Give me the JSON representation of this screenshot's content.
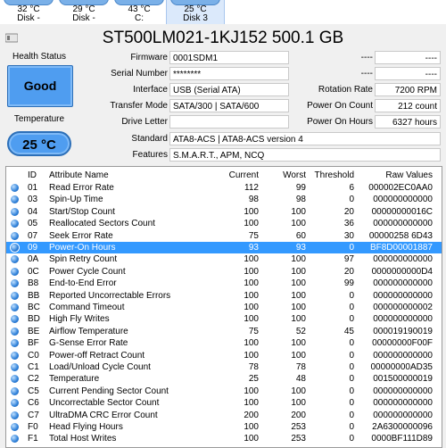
{
  "disks": [
    {
      "temp": "32 °C",
      "name": "Disk -"
    },
    {
      "temp": "29 °C",
      "name": "Disk -"
    },
    {
      "temp": "43 °C",
      "name": "C:"
    },
    {
      "temp": "25 °C",
      "name": "Disk 3"
    }
  ],
  "title": "ST500LM021-1KJ152 500.1 GB",
  "health": {
    "caption": "Health Status",
    "value": "Good",
    "color": "#4f9df0"
  },
  "temperature": {
    "caption": "Temperature",
    "value": "25 °C"
  },
  "info_left": [
    {
      "label": "Firmware",
      "value": "0001SDM1"
    },
    {
      "label": "Serial Number",
      "value": "********"
    },
    {
      "label": "Interface",
      "value": "USB (Serial ATA)"
    },
    {
      "label": "Transfer Mode",
      "value": "SATA/300 | SATA/600"
    },
    {
      "label": "Drive Letter",
      "value": ""
    }
  ],
  "info_right": [
    {
      "label": "----",
      "value": "----"
    },
    {
      "label": "----",
      "value": "----"
    },
    {
      "label": "Rotation Rate",
      "value": "7200 RPM"
    },
    {
      "label": "Power On Count",
      "value": "212 count"
    },
    {
      "label": "Power On Hours",
      "value": "6327 hours"
    }
  ],
  "standard": {
    "label": "Standard",
    "value": "ATA8-ACS | ATA8-ACS version 4"
  },
  "features": {
    "label": "Features",
    "value": "S.M.A.R.T., APM, NCQ"
  },
  "table": {
    "headers": [
      "ID",
      "Attribute Name",
      "Current",
      "Worst",
      "Threshold",
      "Raw Values"
    ],
    "rows": [
      {
        "id": "01",
        "name": "Read Error Rate",
        "cur": "112",
        "worst": "99",
        "thr": "6",
        "raw": "000002EC0AA0"
      },
      {
        "id": "03",
        "name": "Spin-Up Time",
        "cur": "98",
        "worst": "98",
        "thr": "0",
        "raw": "000000000000"
      },
      {
        "id": "04",
        "name": "Start/Stop Count",
        "cur": "100",
        "worst": "100",
        "thr": "20",
        "raw": "00000000016C"
      },
      {
        "id": "05",
        "name": "Reallocated Sectors Count",
        "cur": "100",
        "worst": "100",
        "thr": "36",
        "raw": "000000000000"
      },
      {
        "id": "07",
        "name": "Seek Error Rate",
        "cur": "75",
        "worst": "60",
        "thr": "30",
        "raw": "00000258 6D43"
      },
      {
        "id": "09",
        "name": "Power-On Hours",
        "cur": "93",
        "worst": "93",
        "thr": "0",
        "raw": "BF8D00001887"
      },
      {
        "id": "0A",
        "name": "Spin Retry Count",
        "cur": "100",
        "worst": "100",
        "thr": "97",
        "raw": "000000000000"
      },
      {
        "id": "0C",
        "name": "Power Cycle Count",
        "cur": "100",
        "worst": "100",
        "thr": "20",
        "raw": "0000000000D4"
      },
      {
        "id": "B8",
        "name": "End-to-End Error",
        "cur": "100",
        "worst": "100",
        "thr": "99",
        "raw": "000000000000"
      },
      {
        "id": "BB",
        "name": "Reported Uncorrectable Errors",
        "cur": "100",
        "worst": "100",
        "thr": "0",
        "raw": "000000000000"
      },
      {
        "id": "BC",
        "name": "Command Timeout",
        "cur": "100",
        "worst": "100",
        "thr": "0",
        "raw": "000000000002"
      },
      {
        "id": "BD",
        "name": "High Fly Writes",
        "cur": "100",
        "worst": "100",
        "thr": "0",
        "raw": "000000000000"
      },
      {
        "id": "BE",
        "name": "Airflow Temperature",
        "cur": "75",
        "worst": "52",
        "thr": "45",
        "raw": "000019190019"
      },
      {
        "id": "BF",
        "name": "G-Sense Error Rate",
        "cur": "100",
        "worst": "100",
        "thr": "0",
        "raw": "00000000F00F"
      },
      {
        "id": "C0",
        "name": "Power-off Retract Count",
        "cur": "100",
        "worst": "100",
        "thr": "0",
        "raw": "000000000000"
      },
      {
        "id": "C1",
        "name": "Load/Unload Cycle Count",
        "cur": "78",
        "worst": "78",
        "thr": "0",
        "raw": "00000000AD35"
      },
      {
        "id": "C2",
        "name": "Temperature",
        "cur": "25",
        "worst": "48",
        "thr": "0",
        "raw": "001500000019"
      },
      {
        "id": "C5",
        "name": "Current Pending Sector Count",
        "cur": "100",
        "worst": "100",
        "thr": "0",
        "raw": "000000000000"
      },
      {
        "id": "C6",
        "name": "Uncorrectable Sector Count",
        "cur": "100",
        "worst": "100",
        "thr": "0",
        "raw": "000000000000"
      },
      {
        "id": "C7",
        "name": "UltraDMA CRC Error Count",
        "cur": "200",
        "worst": "200",
        "thr": "0",
        "raw": "000000000000"
      },
      {
        "id": "F0",
        "name": "Head Flying Hours",
        "cur": "100",
        "worst": "253",
        "thr": "0",
        "raw": "2A6300000096"
      },
      {
        "id": "F1",
        "name": "Total Host Writes",
        "cur": "100",
        "worst": "253",
        "thr": "0",
        "raw": "0000BF111D89"
      }
    ],
    "selected_index": 5
  }
}
